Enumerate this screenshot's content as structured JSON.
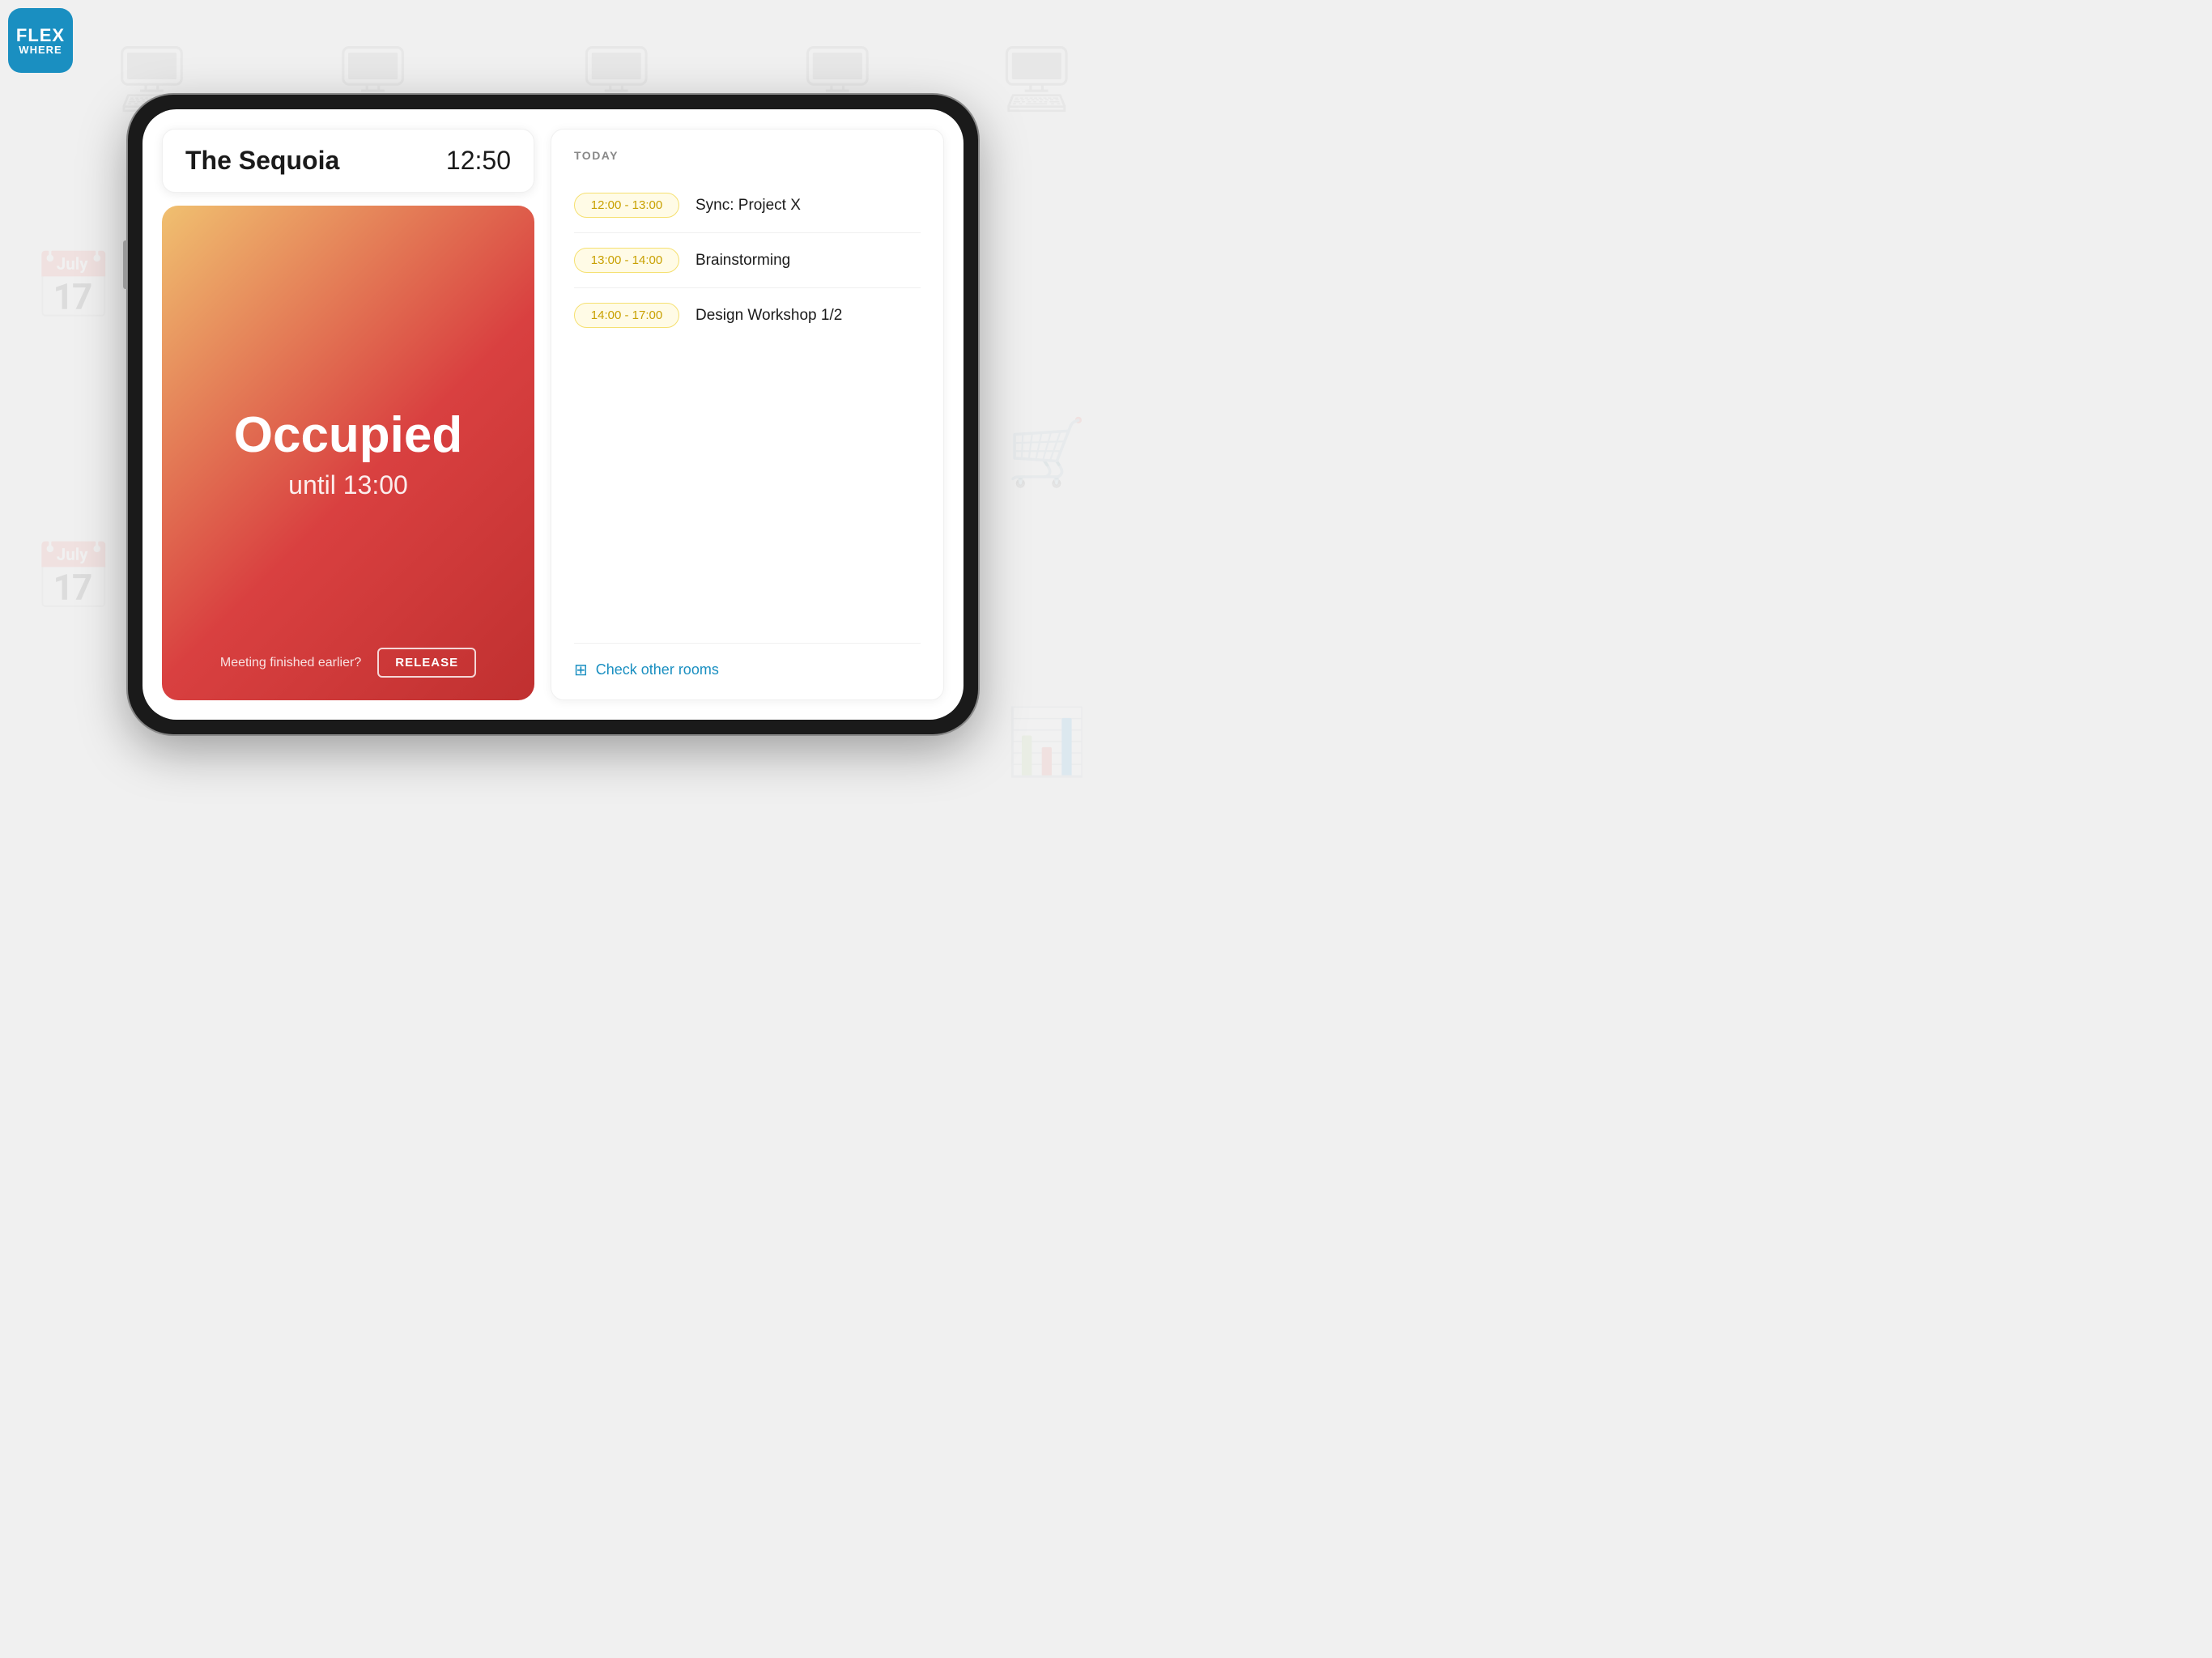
{
  "logo": {
    "flex": "FLEX",
    "where": "WHERE"
  },
  "header": {
    "room_name": "The Sequoia",
    "current_time": "12:50"
  },
  "status_card": {
    "status": "Occupied",
    "until_text": "until 13:00",
    "release_question": "Meeting finished earlier?",
    "release_button": "RELEASE"
  },
  "schedule": {
    "today_label": "TODAY",
    "items": [
      {
        "time": "12:00 - 13:00",
        "event": "Sync: Project X"
      },
      {
        "time": "13:00 - 14:00",
        "event": "Brainstorming"
      },
      {
        "time": "14:00 - 17:00",
        "event": "Design Workshop 1/2"
      }
    ],
    "check_rooms": "Check other rooms"
  }
}
